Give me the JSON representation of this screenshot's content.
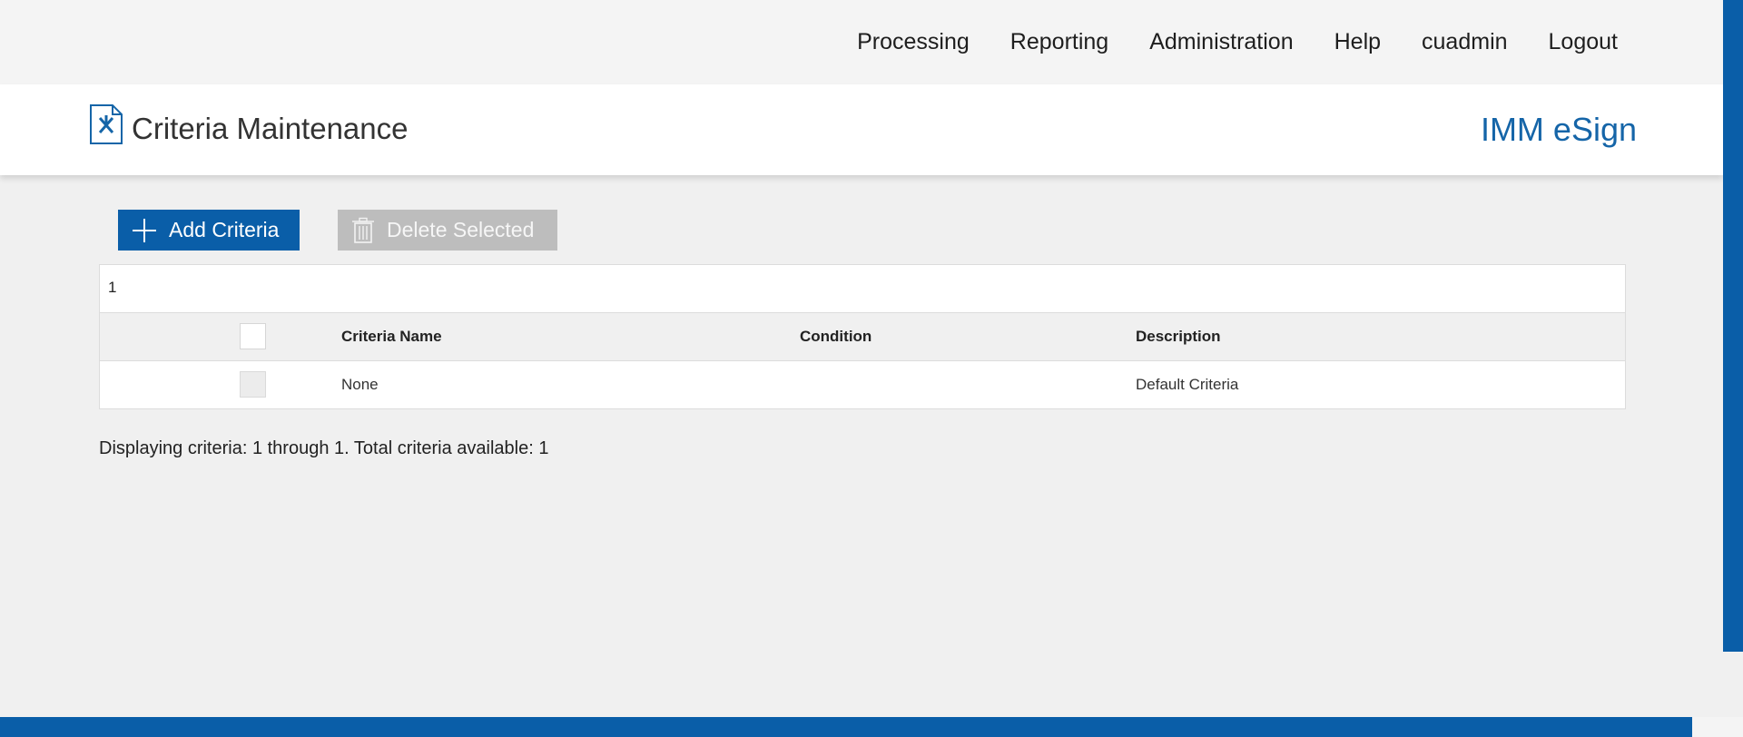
{
  "topnav": {
    "items": [
      {
        "label": "Processing"
      },
      {
        "label": "Reporting"
      },
      {
        "label": "Administration"
      },
      {
        "label": "Help"
      },
      {
        "label": "cuadmin"
      },
      {
        "label": "Logout"
      }
    ]
  },
  "header": {
    "icon": "document-tools-icon",
    "title": "Criteria Maintenance",
    "brand": "IMM eSign"
  },
  "toolbar": {
    "add_label": "Add Criteria",
    "add_icon": "plus-icon",
    "delete_label": "Delete Selected",
    "delete_icon": "trash-icon"
  },
  "table": {
    "page": "1",
    "columns": [
      "Criteria Name",
      "Condition",
      "Description"
    ],
    "rows": [
      {
        "name": "None",
        "condition": "",
        "description": "Default Criteria"
      }
    ]
  },
  "status": "Displaying criteria: 1 through 1. Total criteria available: 1",
  "colors": {
    "accent": "#0a5ea8",
    "brand": "#1565a8",
    "disabled": "#bdbdbd"
  }
}
